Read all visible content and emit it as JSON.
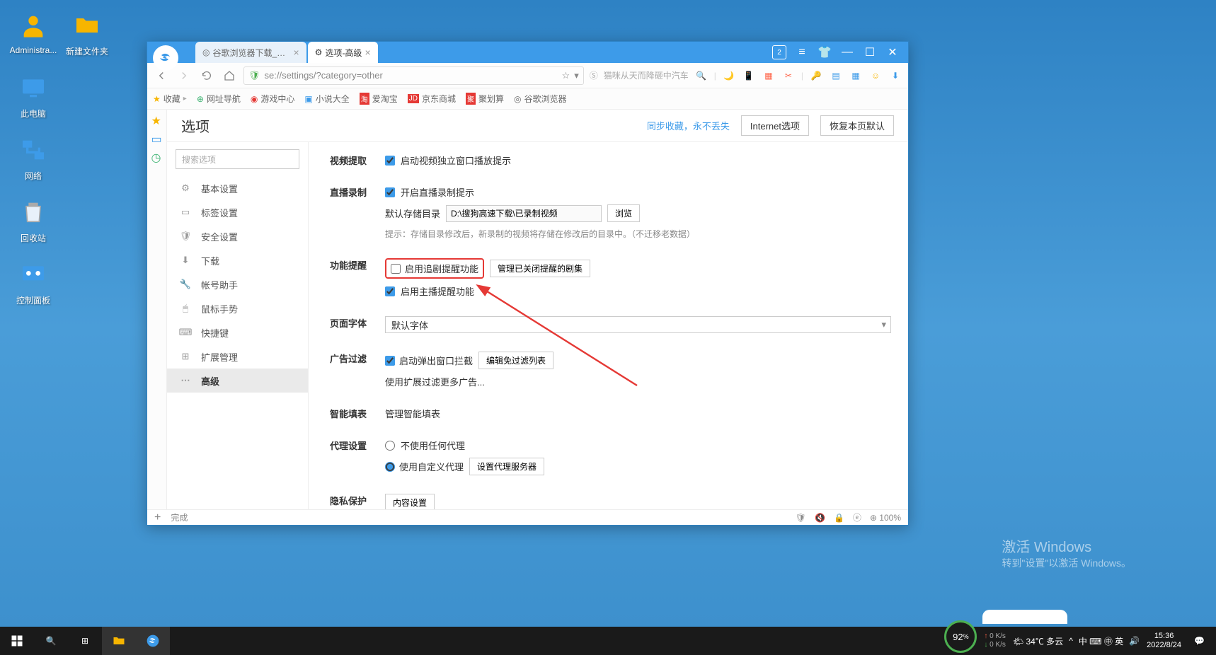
{
  "desktop": {
    "icons": [
      {
        "label": "Administra...",
        "type": "user"
      },
      {
        "label": "新建文件夹",
        "type": "folder"
      },
      {
        "label": "此电脑",
        "type": "pc"
      },
      {
        "label": "网络",
        "type": "network"
      },
      {
        "label": "回收站",
        "type": "recycle"
      },
      {
        "label": "控制面板",
        "type": "control"
      }
    ]
  },
  "browser": {
    "tabs": [
      {
        "title": "谷歌浏览器下载_浏览器",
        "active": false
      },
      {
        "title": "选项-高级",
        "active": true
      }
    ],
    "address": "se://settings/?category=other",
    "search_placeholder": "猫咪从天而降砸中汽车",
    "bookmarks": [
      "收藏",
      "网址导航",
      "游戏中心",
      "小说大全",
      "爱淘宝",
      "京东商城",
      "聚划算",
      "谷歌浏览器"
    ],
    "nav_star": "★"
  },
  "settings": {
    "title": "选项",
    "sync_link": "同步收藏，永不丢失",
    "internet_btn": "Internet选项",
    "restore_btn": "恢复本页默认",
    "search_placeholder": "搜索选项",
    "sidebar": [
      {
        "label": "基本设置"
      },
      {
        "label": "标签设置"
      },
      {
        "label": "安全设置"
      },
      {
        "label": "下载"
      },
      {
        "label": "帐号助手"
      },
      {
        "label": "鼠标手势"
      },
      {
        "label": "快捷键"
      },
      {
        "label": "扩展管理"
      },
      {
        "label": "高级",
        "active": true
      }
    ],
    "sections": {
      "video_extract": {
        "label": "视频提取",
        "checkbox": "启动视频独立窗口播放提示"
      },
      "live_record": {
        "label": "直播录制",
        "checkbox": "开启直播录制提示",
        "path_label": "默认存储目录",
        "path_value": "D:\\搜狗高速下载\\已录制视频",
        "browse_btn": "浏览",
        "hint": "提示：存储目录修改后，新录制的视频将存储在修改后的目录中。（不迁移老数据）"
      },
      "reminder": {
        "label": "功能提醒",
        "chk1": "启用追剧提醒功能",
        "btn1": "管理已关闭提醒的剧集",
        "chk2": "启用主播提醒功能"
      },
      "font": {
        "label": "页面字体",
        "value": "默认字体"
      },
      "ads": {
        "label": "广告过滤",
        "chk": "启动弹出窗口拦截",
        "btn": "编辑免过滤列表",
        "link": "使用扩展过滤更多广告..."
      },
      "smartfill": {
        "label": "智能填表",
        "link": "管理智能填表"
      },
      "proxy": {
        "label": "代理设置",
        "opt1": "不使用任何代理",
        "opt2": "使用自定义代理",
        "btn": "设置代理服务器"
      },
      "privacy": {
        "label": "隐私保护",
        "btn": "内容设置"
      }
    }
  },
  "status": {
    "done": "完成",
    "zoom": "100%"
  },
  "watermark": {
    "title": "激活 Windows",
    "sub": "转到\"设置\"以激活 Windows。"
  },
  "taskbar": {
    "battery": "92",
    "net_up": "0 K/s",
    "net_dn": "0 K/s",
    "weather": "34℃ 多云",
    "ime": "中 ⌨ ㊥ 英",
    "time": "15:36",
    "date": "2022/8/24"
  }
}
